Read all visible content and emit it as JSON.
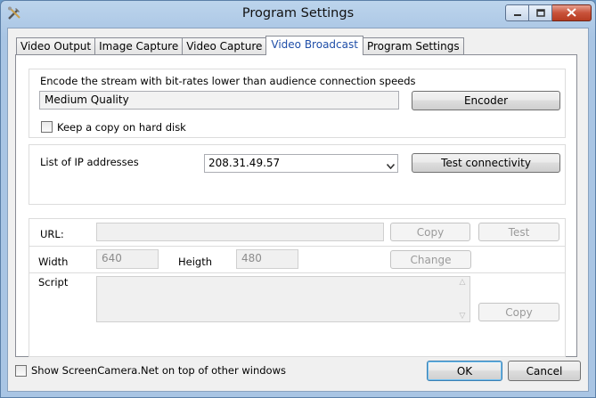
{
  "window": {
    "title": "Program Settings"
  },
  "tabs": [
    {
      "label": "Video Output",
      "active": false
    },
    {
      "label": "Image Capture",
      "active": false
    },
    {
      "label": "Video Capture",
      "active": false
    },
    {
      "label": "Video Broadcast",
      "active": true
    },
    {
      "label": "Program Settings",
      "active": false
    }
  ],
  "encode": {
    "label": "Encode the stream with bit-rates lower than audience connection speeds",
    "quality_value": "Medium Quality",
    "encoder_button": "Encoder"
  },
  "keep_copy": {
    "label": "Keep a copy on hard disk",
    "checked": false
  },
  "ip": {
    "label": "List of IP addresses",
    "selected": "208.31.49.57",
    "test_button": "Test connectivity"
  },
  "url": {
    "label": "URL:",
    "value": "",
    "copy_button": "Copy",
    "test_button": "Test"
  },
  "size": {
    "width_label": "Width",
    "width_value": "640",
    "height_label": "Heigth",
    "height_value": "480",
    "change_button": "Change"
  },
  "script": {
    "label": "Script",
    "value": "",
    "copy_button": "Copy"
  },
  "footer": {
    "on_top_label": "Show ScreenCamera.Net on top of other windows",
    "on_top_checked": false,
    "ok_button": "OK",
    "cancel_button": "Cancel"
  },
  "colors": {
    "active_tab_text": "#1f4ea8",
    "close_button": "#c8523a"
  }
}
